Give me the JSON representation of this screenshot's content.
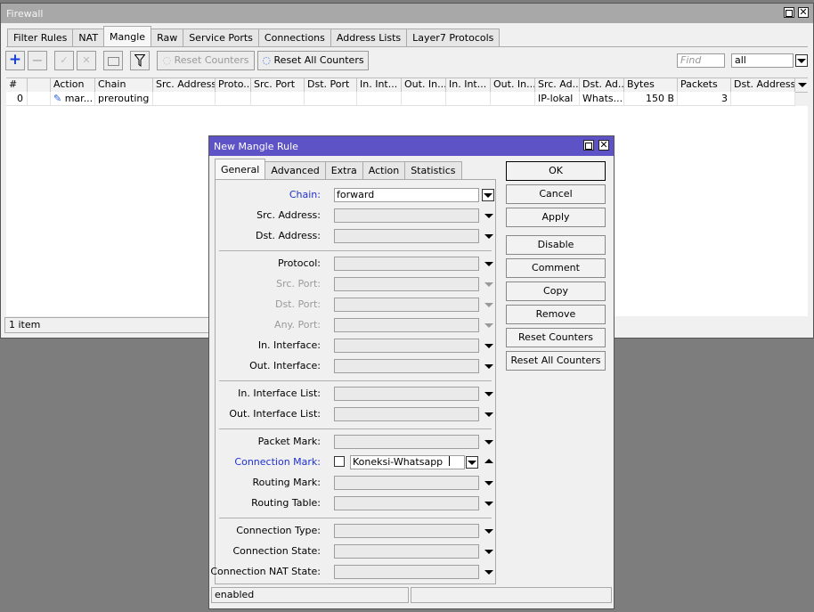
{
  "firewall": {
    "title": "Firewall",
    "tabs": [
      "Filter Rules",
      "NAT",
      "Mangle",
      "Raw",
      "Service Ports",
      "Connections",
      "Address Lists",
      "Layer7 Protocols"
    ],
    "active_tab": "Mangle",
    "toolbar": {
      "reset_counters": "Reset Counters",
      "reset_all_counters": "Reset All Counters",
      "find_placeholder": "Find",
      "filter_value": "all"
    },
    "columns": [
      "#",
      "",
      "Action",
      "Chain",
      "Src. Address",
      "Proto...",
      "Src. Port",
      "Dst. Port",
      "In. Int...",
      "Out. In...",
      "In. Int...",
      "Out. In...",
      "Src. Ad...",
      "Dst. Ad...",
      "Bytes",
      "Packets",
      "Dst. Address"
    ],
    "rows": [
      {
        "num": "0",
        "flag": "",
        "action": "mar...",
        "chain": "prerouting",
        "src_address": "",
        "protocol": "",
        "src_port": "",
        "dst_port": "",
        "in_int": "",
        "out_int": "",
        "in_int_list": "",
        "out_int_list": "",
        "src_addr_list": "IP-lokal",
        "dst_addr_list": "Whats...",
        "bytes": "150 B",
        "packets": "3",
        "dst_address": ""
      }
    ],
    "status": "1 item"
  },
  "dialog": {
    "title": "New Mangle Rule",
    "tabs": [
      "General",
      "Advanced",
      "Extra",
      "Action",
      "Statistics"
    ],
    "active_tab": "General",
    "fields": {
      "chain": {
        "label": "Chain:",
        "value": "forward"
      },
      "src_address": {
        "label": "Src. Address:",
        "value": ""
      },
      "dst_address": {
        "label": "Dst. Address:",
        "value": ""
      },
      "protocol": {
        "label": "Protocol:",
        "value": ""
      },
      "src_port": {
        "label": "Src. Port:",
        "value": ""
      },
      "dst_port": {
        "label": "Dst. Port:",
        "value": ""
      },
      "any_port": {
        "label": "Any. Port:",
        "value": ""
      },
      "in_interface": {
        "label": "In. Interface:",
        "value": ""
      },
      "out_interface": {
        "label": "Out. Interface:",
        "value": ""
      },
      "in_interface_list": {
        "label": "In. Interface List:",
        "value": ""
      },
      "out_interface_list": {
        "label": "Out. Interface List:",
        "value": ""
      },
      "packet_mark": {
        "label": "Packet Mark:",
        "value": ""
      },
      "connection_mark": {
        "label": "Connection Mark:",
        "value": "Koneksi-Whatsapp",
        "negate": false
      },
      "routing_mark": {
        "label": "Routing Mark:",
        "value": ""
      },
      "routing_table": {
        "label": "Routing Table:",
        "value": ""
      },
      "connection_type": {
        "label": "Connection Type:",
        "value": ""
      },
      "connection_state": {
        "label": "Connection State:",
        "value": ""
      },
      "connection_nat_state": {
        "label": "Connection NAT State:",
        "value": ""
      }
    },
    "buttons": {
      "ok": "OK",
      "cancel": "Cancel",
      "apply": "Apply",
      "disable": "Disable",
      "comment": "Comment",
      "copy": "Copy",
      "remove": "Remove",
      "reset_counters": "Reset Counters",
      "reset_all_counters": "Reset All Counters"
    },
    "status": "enabled"
  },
  "colors": {
    "dialog_title_bg": "#5d52c6",
    "link_label": "#1f2fd0",
    "add_icon": "#1a3fd6"
  }
}
